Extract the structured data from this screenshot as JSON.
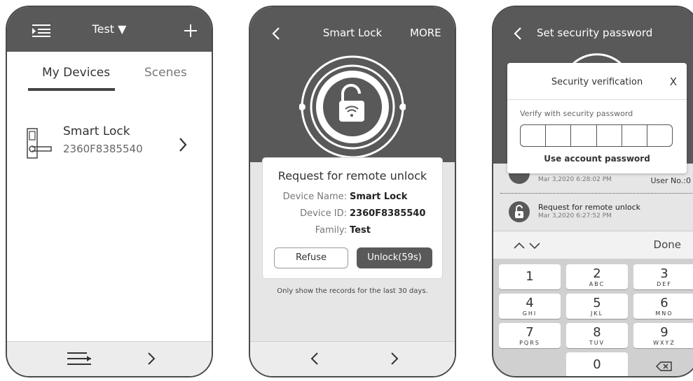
{
  "screen1": {
    "header_title": "Test ▼",
    "tabs": [
      "My Devices",
      "Scenes"
    ],
    "device": {
      "name": "Smart Lock",
      "id": "2360F8385540"
    }
  },
  "screen2": {
    "header_title": "Smart Lock",
    "more_label": "MORE",
    "dialog": {
      "title": "Request for remote unlock",
      "fields": [
        {
          "label": "Device Name:",
          "value": "Smart Lock"
        },
        {
          "label": "Device ID:",
          "value": "2360F8385540"
        },
        {
          "label": "Family:",
          "value": "Test"
        }
      ],
      "refuse_label": "Refuse",
      "unlock_label": "Unlock(59s)"
    },
    "note": "Only show the records for the last 30 days."
  },
  "screen3": {
    "header_title": "Set security password",
    "dialog": {
      "title": "Security verification",
      "close": "X",
      "label": "Verify with security password",
      "link": "Use account password"
    },
    "records": [
      {
        "title": "",
        "time": "Mar 3,2020 6:28:02 PM",
        "user": "User No.:0"
      },
      {
        "title": "Request for remote unlock",
        "time": "Mar 3,2020 6:27:52 PM"
      }
    ],
    "keyboard": {
      "done": "Done",
      "keys": [
        {
          "num": "1",
          "letters": ""
        },
        {
          "num": "2",
          "letters": "ABC"
        },
        {
          "num": "3",
          "letters": "DEF"
        },
        {
          "num": "4",
          "letters": "GHI"
        },
        {
          "num": "5",
          "letters": "JKL"
        },
        {
          "num": "6",
          "letters": "MNO"
        },
        {
          "num": "7",
          "letters": "PQRS"
        },
        {
          "num": "8",
          "letters": "TUV"
        },
        {
          "num": "9",
          "letters": "WXYZ"
        },
        {
          "num": "0",
          "letters": ""
        }
      ]
    }
  },
  "colors": {
    "header": "#595959",
    "button_dark": "#595959",
    "panel": "#e6e6e6"
  }
}
